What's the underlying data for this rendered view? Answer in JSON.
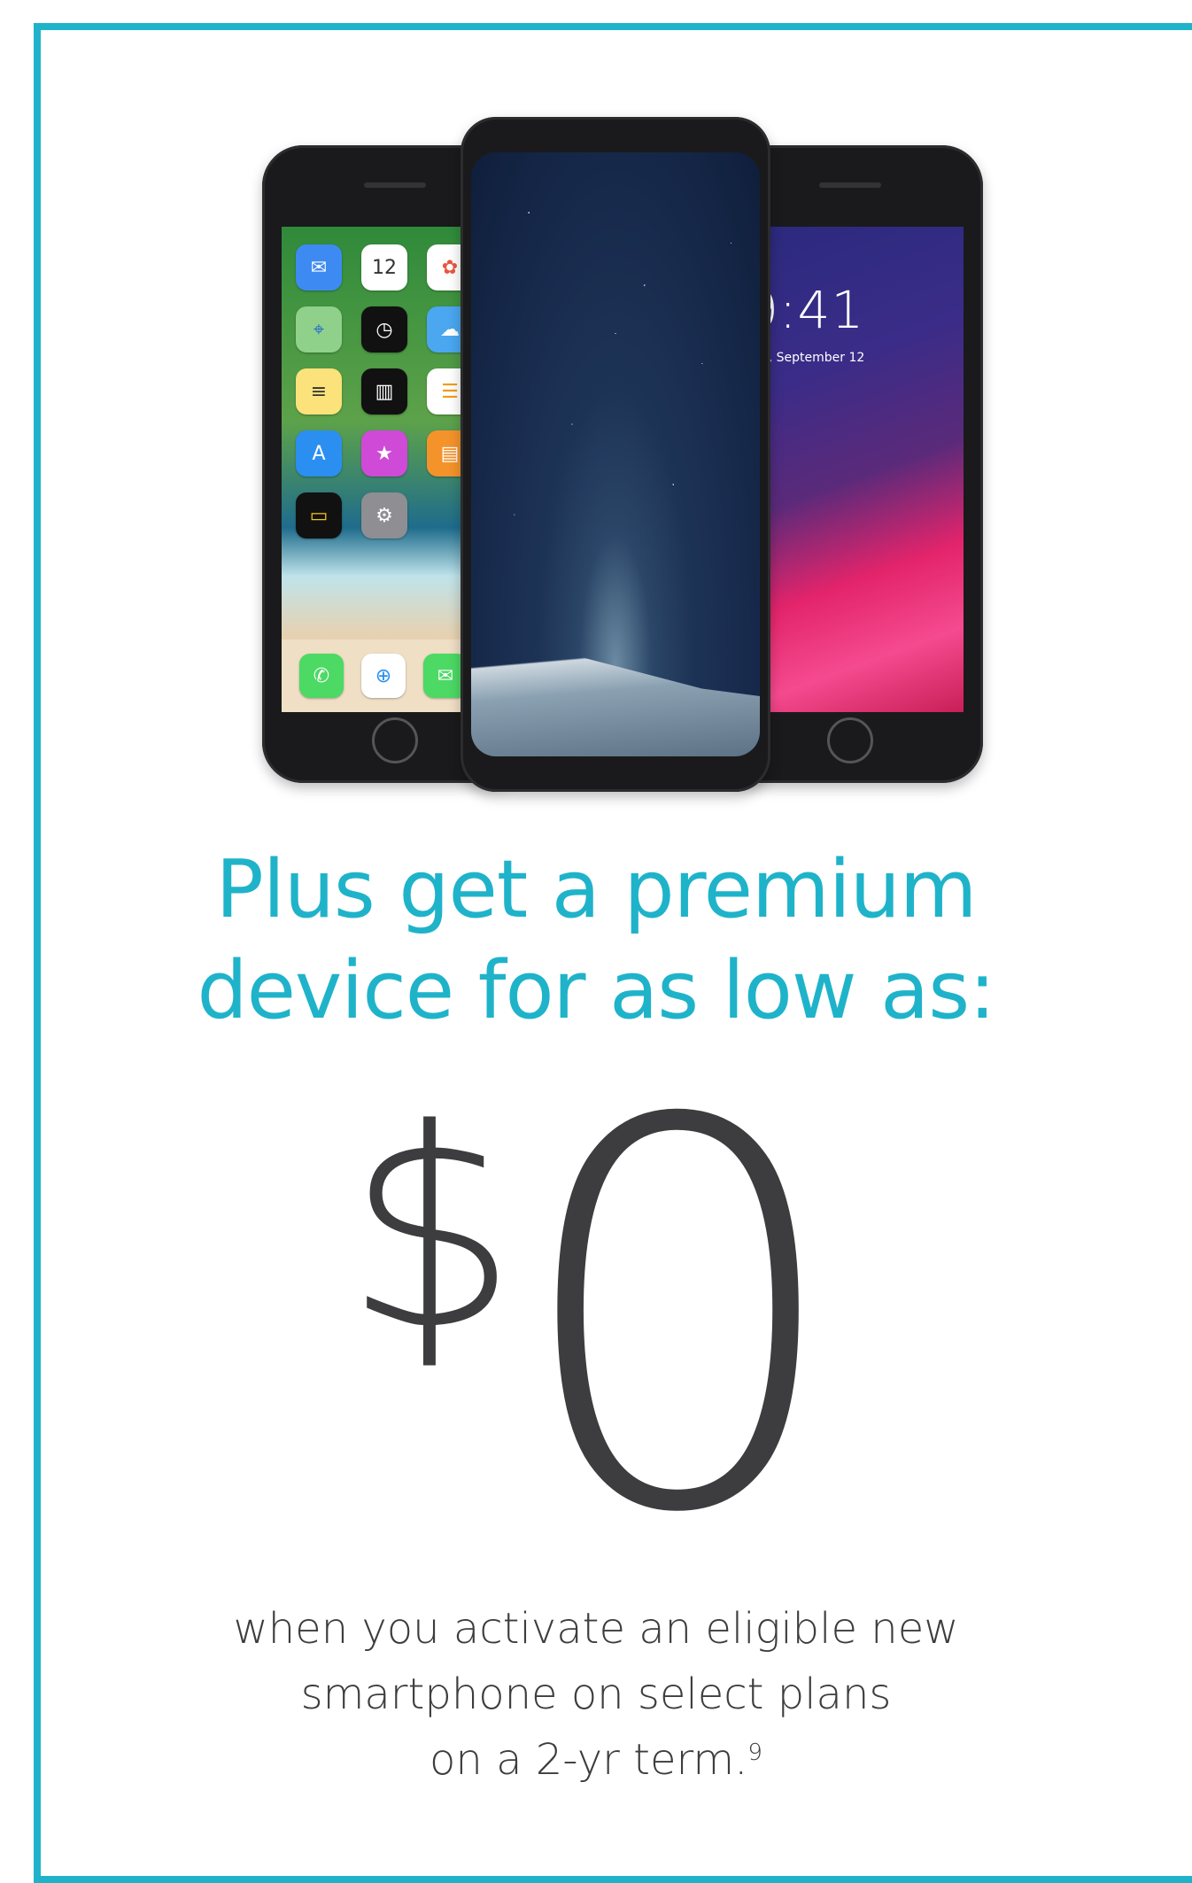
{
  "headline": {
    "line1": "Plus get a premium",
    "line2": "device for as low as:"
  },
  "price": {
    "currency": "$",
    "amount": "0"
  },
  "subtext": {
    "line1": "when you activate an eligible new",
    "line2": "smartphone on select plans",
    "line3": "on a 2-yr term.",
    "footnote": "9"
  },
  "phones": {
    "left_phone": {
      "apps": [
        "mail-icon",
        "calendar-icon",
        "photos-icon",
        "maps-icon",
        "clock-icon",
        "weather-icon",
        "notes-icon",
        "stocks-icon",
        "reminders-icon",
        "app-store-icon",
        "itunes-icon",
        "books-icon",
        "wallet-icon",
        "settings-icon"
      ],
      "calendar_day": "12",
      "dock": [
        "phone-icon",
        "safari-icon",
        "messages-icon"
      ]
    },
    "right_phone": {
      "lock_time": "9:41",
      "lock_date": "day, September 12"
    }
  },
  "colors": {
    "accent": "#1fb3ca",
    "text": "#3d3d3f"
  }
}
